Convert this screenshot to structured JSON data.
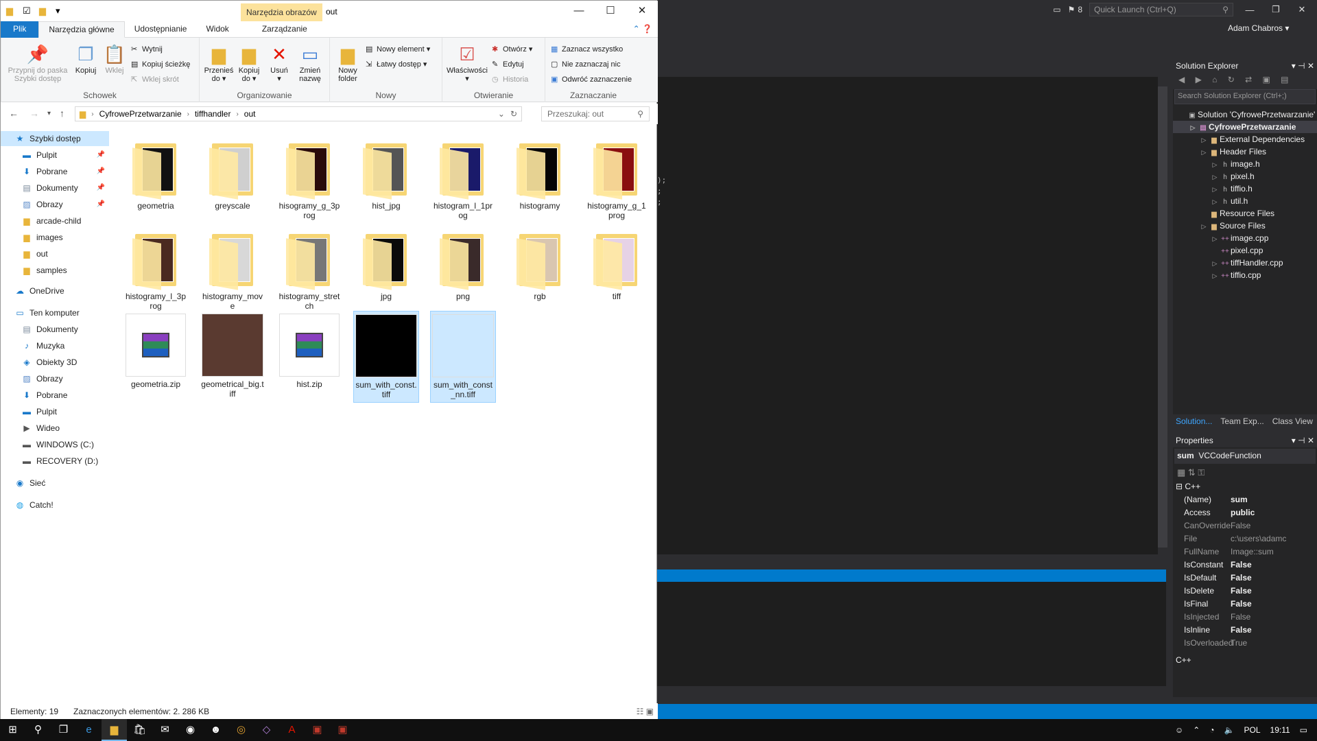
{
  "vs": {
    "notifications": "8",
    "quick_launch": "Quick Launch (Ctrl+Q)",
    "user": "Adam Chabros",
    "solution_explorer": {
      "title": "Solution Explorer",
      "search_placeholder": "Search Solution Explorer (Ctrl+;)",
      "items": [
        {
          "label": "Solution 'CyfrowePrzetwarzanie' (1 project)",
          "icon": "solution-icon"
        },
        {
          "label": "CyfrowePrzetwarzanie",
          "icon": "project-icon"
        },
        {
          "label": "External Dependencies",
          "icon": "folder-icon"
        },
        {
          "label": "Header Files",
          "icon": "folder-icon"
        },
        {
          "label": "image.h",
          "icon": "header-icon"
        },
        {
          "label": "pixel.h",
          "icon": "header-icon"
        },
        {
          "label": "tiffio.h",
          "icon": "header-icon"
        },
        {
          "label": "util.h",
          "icon": "header-icon"
        },
        {
          "label": "Resource Files",
          "icon": "folder-icon"
        },
        {
          "label": "Source Files",
          "icon": "folder-icon"
        },
        {
          "label": "image.cpp",
          "icon": "cpp-icon"
        },
        {
          "label": "pixel.cpp",
          "icon": "cpp-icon"
        },
        {
          "label": "tiffHandler.cpp",
          "icon": "cpp-icon"
        },
        {
          "label": "tiffio.cpp",
          "icon": "cpp-icon"
        }
      ],
      "tabs": [
        "Solution...",
        "Team Exp...",
        "Class View"
      ]
    },
    "properties": {
      "title": "Properties",
      "object": "sum",
      "object_type": "VCCodeFunction",
      "category": "C++",
      "rows": [
        {
          "k": "(Name)",
          "v": "sum"
        },
        {
          "k": "Access",
          "v": "public"
        },
        {
          "k": "CanOverride",
          "v": "False"
        },
        {
          "k": "File",
          "v": "c:\\users\\adamc"
        },
        {
          "k": "FullName",
          "v": "Image::sum"
        },
        {
          "k": "IsConstant",
          "v": "False"
        },
        {
          "k": "IsDefault",
          "v": "False"
        },
        {
          "k": "IsDelete",
          "v": "False"
        },
        {
          "k": "IsFinal",
          "v": "False"
        },
        {
          "k": "IsInjected",
          "v": "False"
        },
        {
          "k": "IsInline",
          "v": "False"
        },
        {
          "k": "IsOverloaded",
          "v": "True"
        }
      ],
      "footer": "C++"
    }
  },
  "explorer": {
    "context_tab": "Narzędzia obrazów",
    "title": "out",
    "tabs": [
      "Plik",
      "Narzędzia główne",
      "Udostępnianie",
      "Widok",
      "Zarządzanie"
    ],
    "ribbon": {
      "schowek": {
        "label": "Schowek",
        "pin": "Przypnij do paska Szybki dostęp",
        "copy": "Kopiuj",
        "paste": "Wklej",
        "cut": "Wytnij",
        "copy_path": "Kopiuj ścieżkę",
        "paste_shortcut": "Wklej skrót"
      },
      "organizowanie": {
        "label": "Organizowanie",
        "move": "Przenieś do",
        "copy_to": "Kopiuj do",
        "delete": "Usuń",
        "rename": "Zmień nazwę"
      },
      "nowy": {
        "label": "Nowy",
        "new_folder": "Nowy folder",
        "new_item": "Nowy element",
        "easy_access": "Łatwy dostęp"
      },
      "otwieranie": {
        "label": "Otwieranie",
        "properties": "Właściwości",
        "open": "Otwórz",
        "edit": "Edytuj",
        "history": "Historia"
      },
      "zaznaczanie": {
        "label": "Zaznaczanie",
        "select_all": "Zaznacz wszystko",
        "select_none": "Nie zaznaczaj nic",
        "invert": "Odwróć zaznaczenie"
      }
    },
    "address": [
      "CyfrowePrzetwarzanie",
      "tiffhandler",
      "out"
    ],
    "search_placeholder": "Przeszukaj: out",
    "nav": [
      {
        "label": "Szybki dostęp",
        "icon": "star-icon",
        "pinned": false,
        "selected": true
      },
      {
        "label": "Pulpit",
        "icon": "desktop-icon",
        "pinned": true
      },
      {
        "label": "Pobrane",
        "icon": "download-icon",
        "pinned": true
      },
      {
        "label": "Dokumenty",
        "icon": "documents-icon",
        "pinned": true
      },
      {
        "label": "Obrazy",
        "icon": "pictures-icon",
        "pinned": true
      },
      {
        "label": "arcade-child",
        "icon": "folder-icon"
      },
      {
        "label": "images",
        "icon": "folder-icon"
      },
      {
        "label": "out",
        "icon": "folder-icon"
      },
      {
        "label": "samples",
        "icon": "folder-icon"
      },
      {
        "label": "OneDrive",
        "icon": "cloud-icon"
      },
      {
        "label": "Ten komputer",
        "icon": "computer-icon"
      },
      {
        "label": "Dokumenty",
        "icon": "documents-icon"
      },
      {
        "label": "Muzyka",
        "icon": "music-icon"
      },
      {
        "label": "Obiekty 3D",
        "icon": "cube-icon"
      },
      {
        "label": "Obrazy",
        "icon": "pictures-icon"
      },
      {
        "label": "Pobrane",
        "icon": "download-icon"
      },
      {
        "label": "Pulpit",
        "icon": "desktop-icon"
      },
      {
        "label": "Wideo",
        "icon": "video-icon"
      },
      {
        "label": "WINDOWS (C:)",
        "icon": "drive-icon"
      },
      {
        "label": "RECOVERY (D:)",
        "icon": "drive-icon"
      },
      {
        "label": "Sieć",
        "icon": "network-icon"
      },
      {
        "label": "Catch!",
        "icon": "catch-icon"
      }
    ],
    "items": [
      {
        "name": "geometria",
        "type": "folder",
        "img": "#111111"
      },
      {
        "name": "greyscale",
        "type": "folder",
        "img": "#cfcfcf"
      },
      {
        "name": "hisogramy_g_3prog",
        "type": "folder",
        "img": "#2a0a0a"
      },
      {
        "name": "hist_jpg",
        "type": "folder",
        "img": "#555555"
      },
      {
        "name": "histogram_l_1prog",
        "type": "folder",
        "img": "#1a1a6a"
      },
      {
        "name": "histogramy",
        "type": "folder",
        "img": "#050505"
      },
      {
        "name": "histogramy_g_1prog",
        "type": "folder",
        "img": "#8a0f0f"
      },
      {
        "name": "histogramy_l_3prog",
        "type": "folder",
        "img": "#4a2a20"
      },
      {
        "name": "histogramy_move",
        "type": "folder",
        "img": "#d8d8d8"
      },
      {
        "name": "histogramy_stretch",
        "type": "folder",
        "img": "#777777"
      },
      {
        "name": "jpg",
        "type": "folder",
        "img": "#0a0a0a"
      },
      {
        "name": "png",
        "type": "folder",
        "img": "#3a2a2a"
      },
      {
        "name": "rgb",
        "type": "folder",
        "img": "#d9c6b0"
      },
      {
        "name": "tiff",
        "type": "folder",
        "img": "#e6d2e6"
      },
      {
        "name": "geometria.zip",
        "type": "zip"
      },
      {
        "name": "geometrical_big.tiff",
        "type": "image",
        "img": "#5a3a30"
      },
      {
        "name": "hist.zip",
        "type": "zip"
      },
      {
        "name": "sum_with_const.tiff",
        "type": "image",
        "img": "#000000",
        "selected": true
      },
      {
        "name": "sum_with_const_nn.tiff",
        "type": "image",
        "img": "#cce8ff",
        "selected": true
      }
    ],
    "status": {
      "count": "Elementy: 19",
      "selected": "Zaznaczonych elementów: 2. 286 KB"
    }
  },
  "taskbar": {
    "icons": [
      "start-icon",
      "search-icon",
      "task-view-icon",
      "edge-icon",
      "file-explorer-icon",
      "store-icon",
      "mail-icon",
      "app-icon",
      "app2-icon",
      "chrome-icon",
      "visual-studio-icon",
      "acrobat-icon",
      "app3-icon",
      "app4-icon"
    ],
    "lang": "POL",
    "time": "19:11"
  }
}
